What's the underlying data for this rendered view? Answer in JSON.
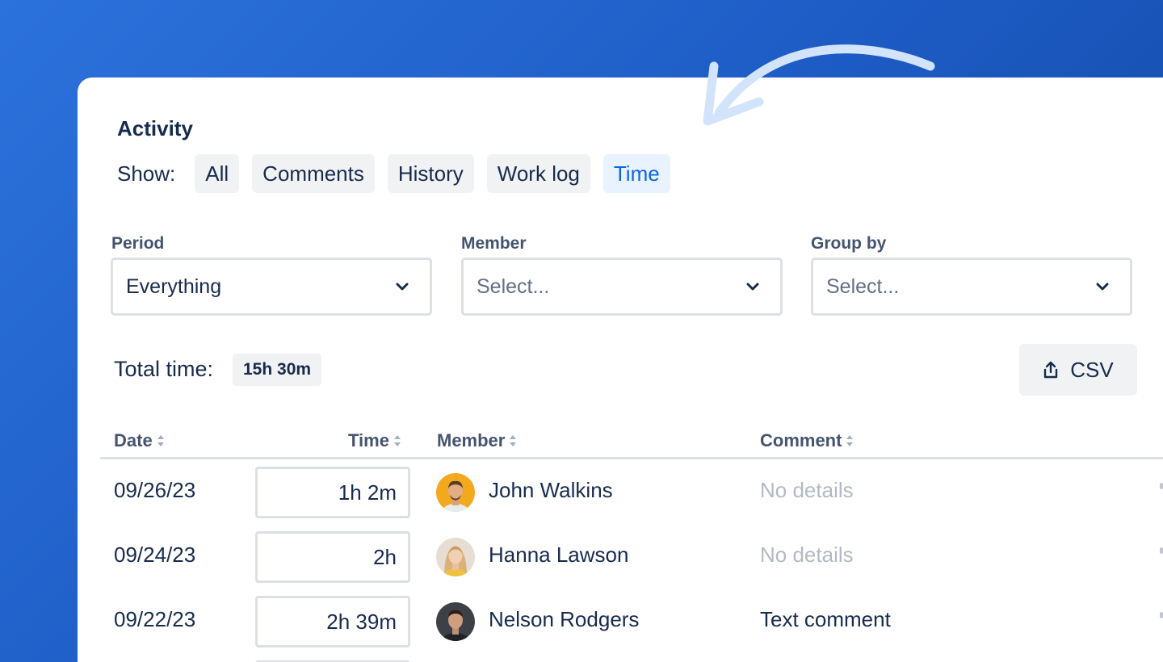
{
  "activity": {
    "title": "Activity",
    "show_label": "Show:",
    "tabs": [
      {
        "label": "All",
        "active": false
      },
      {
        "label": "Comments",
        "active": false
      },
      {
        "label": "History",
        "active": false
      },
      {
        "label": "Work log",
        "active": false
      },
      {
        "label": "Time",
        "active": true
      }
    ]
  },
  "filters": {
    "period": {
      "label": "Period",
      "value": "Everything"
    },
    "member": {
      "label": "Member",
      "placeholder": "Select..."
    },
    "group_by": {
      "label": "Group by",
      "placeholder": "Select..."
    }
  },
  "summary": {
    "total_label": "Total time:",
    "total_value": "15h 30m",
    "export_label": "CSV"
  },
  "table": {
    "headers": {
      "date": "Date",
      "time": "Time",
      "member": "Member",
      "comment": "Comment"
    },
    "rows": [
      {
        "date": "09/26/23",
        "time": "1h 2m",
        "member": "John Walkins",
        "comment": "No details",
        "comment_muted": true
      },
      {
        "date": "09/24/23",
        "time": "2h",
        "member": "Hanna Lawson",
        "comment": "No details",
        "comment_muted": true
      },
      {
        "date": "09/22/23",
        "time": "2h 39m",
        "member": "Nelson Rodgers",
        "comment": "Text comment",
        "comment_muted": false
      }
    ]
  },
  "colors": {
    "accent": "#0c66e4",
    "text": "#172b4d",
    "muted_text": "#b3b9c4",
    "background_gradient_start": "#2c72dc",
    "background_gradient_end": "#0f469e"
  }
}
